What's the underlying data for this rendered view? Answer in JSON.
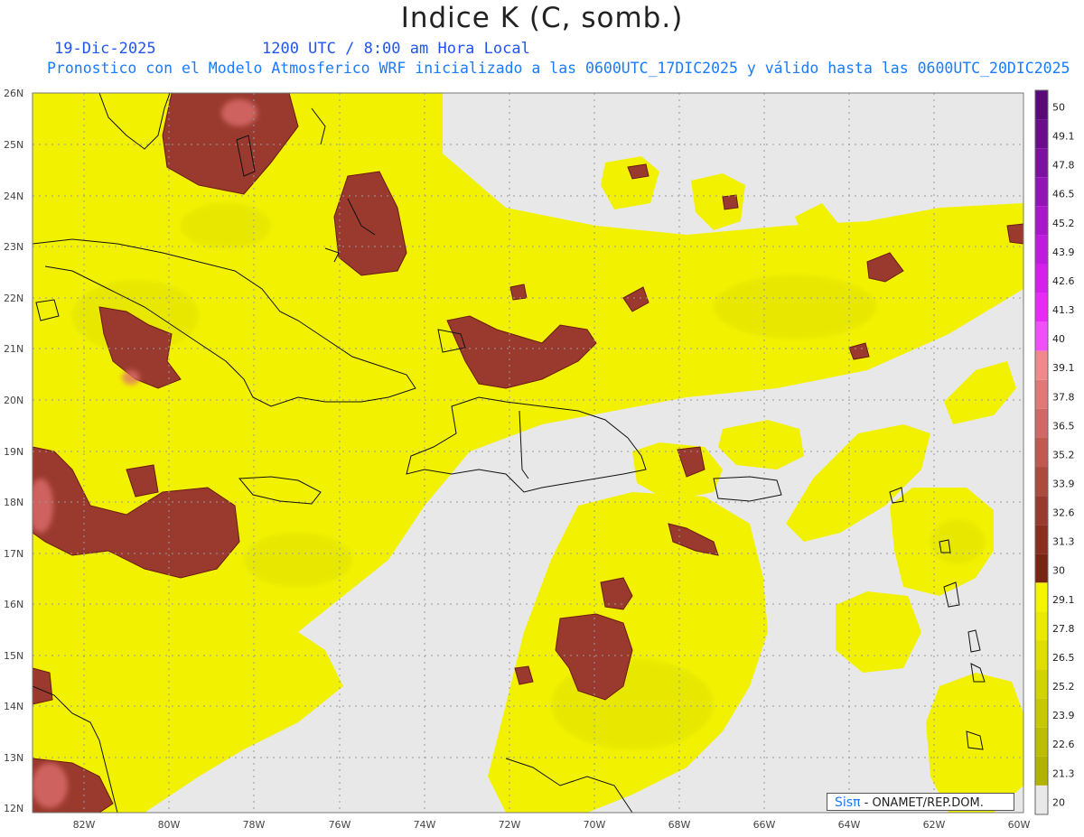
{
  "header": {
    "title": "Indice K (C, somb.)",
    "date": "19-Dic-2025",
    "time": "1200 UTC / 8:00 am Hora Local",
    "description": "Pronostico con el Modelo Atmosferico WRF inicializado a las 0600UTC_17DIC2025 y válido hasta las  0600UTC_20DIC2025"
  },
  "axes": {
    "lat_labels": [
      "26N",
      "25N",
      "24N",
      "23N",
      "22N",
      "21N",
      "20N",
      "19N",
      "18N",
      "17N",
      "16N",
      "15N",
      "14N",
      "13N",
      "12N"
    ],
    "lon_labels": [
      "82W",
      "80W",
      "78W",
      "76W",
      "74W",
      "72W",
      "70W",
      "68W",
      "66W",
      "64W",
      "62W",
      "60W"
    ]
  },
  "colorbar": {
    "labels": [
      "50",
      "49.1",
      "47.8",
      "46.5",
      "45.2",
      "43.9",
      "42.6",
      "41.3",
      "40",
      "39.1",
      "37.8",
      "36.5",
      "35.2",
      "33.9",
      "32.6",
      "31.3",
      "30",
      "29.1",
      "27.8",
      "26.5",
      "25.2",
      "23.9",
      "22.6",
      "21.3",
      "20"
    ],
    "colors": [
      "#5a0a78",
      "#6b0c8c",
      "#7e10a0",
      "#9214b5",
      "#a818c9",
      "#bd1cdc",
      "#d420ea",
      "#e82af5",
      "#f050f8",
      "#f08a8a",
      "#e07878",
      "#d06868",
      "#c05a50",
      "#ad4a3e",
      "#9a3a2e",
      "#8a2e20",
      "#7a2414",
      "#f5f500",
      "#e9ea00",
      "#dede00",
      "#d3d300",
      "#c8c800",
      "#bdbd00",
      "#b2b200",
      "#e8e8e8"
    ]
  },
  "credit": {
    "brand": "Sisπ",
    "text": "- ONAMET/REP.DOM."
  }
}
